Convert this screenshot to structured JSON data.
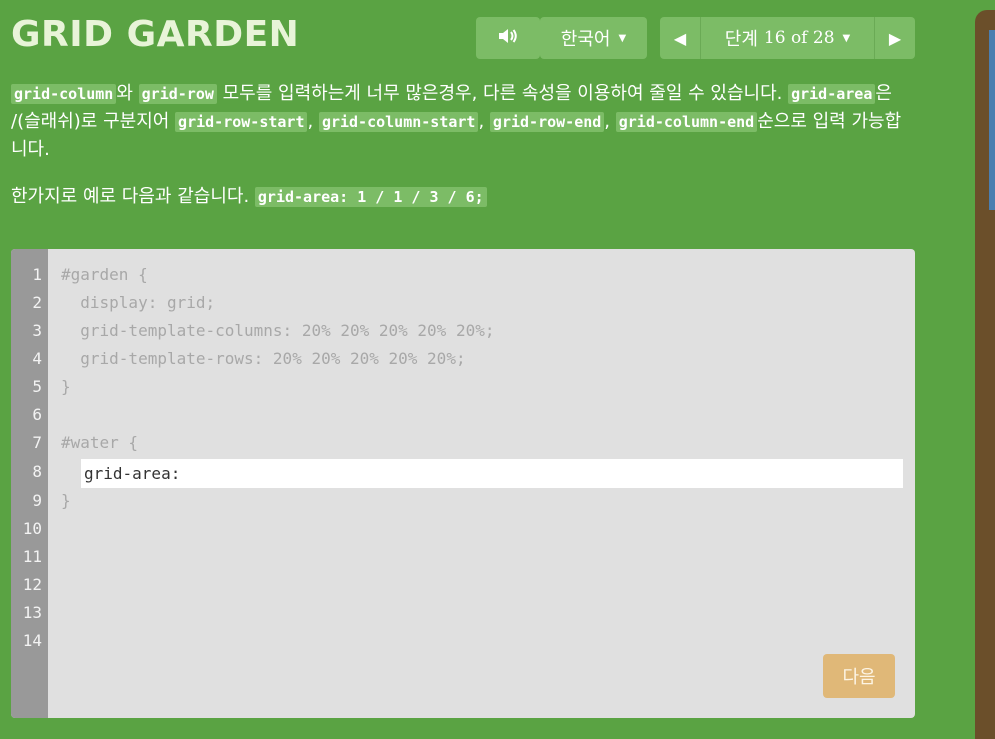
{
  "header": {
    "title": "GRID GARDEN",
    "language_label": "한국어",
    "level_prefix": "단계",
    "level_text": "16 of 28"
  },
  "instructions": {
    "p1": {
      "code_grid_column": "grid-column",
      "t_wa": "와 ",
      "code_grid_row": "grid-row",
      "t_mid": " 모두를 입력하는게 너무 많은경우, 다른 속성을 이용하여 줄일 수 있습니다. ",
      "code_grid_area": "grid-area",
      "t_slash": "은 /(슬래쉬)로 구분지어 ",
      "code_row_start": "grid-row-start",
      "t_comma1": ", ",
      "code_col_start": "grid-column-start",
      "t_comma2": ", ",
      "code_row_end": "grid-row-end",
      "t_comma3": ", ",
      "code_col_end": "grid-column-end",
      "t_end": "순으로 입력 가능합니다."
    },
    "p2": {
      "text": "한가지로 예로 다음과 같습니다. ",
      "code_example": "grid-area: 1 / 1 / 3 / 6;"
    }
  },
  "editor": {
    "line_numbers": [
      "1",
      "2",
      "3",
      "4",
      "5",
      "6",
      "7",
      "8",
      "9",
      "10",
      "11",
      "12",
      "13",
      "14"
    ],
    "lines": {
      "l1": "#garden {",
      "l2": "  display: grid;",
      "l3": "  grid-template-columns: 20% 20% 20% 20% 20%;",
      "l4": "  grid-template-rows: 20% 20% 20% 20% 20%;",
      "l5": "}",
      "l7": "#water {",
      "l9": "}"
    },
    "input_value": "grid-area: ",
    "next_label": "다음"
  },
  "colors": {
    "background": "#5aa343",
    "button": "#7cbc66",
    "editor_bg": "#e0e0e0",
    "gutter": "#999999",
    "next_button": "#e0b878"
  },
  "icons": {
    "sound": "speaker-icon",
    "prev": "triangle-left-icon",
    "next": "triangle-right-icon",
    "caret": "caret-down-icon"
  }
}
